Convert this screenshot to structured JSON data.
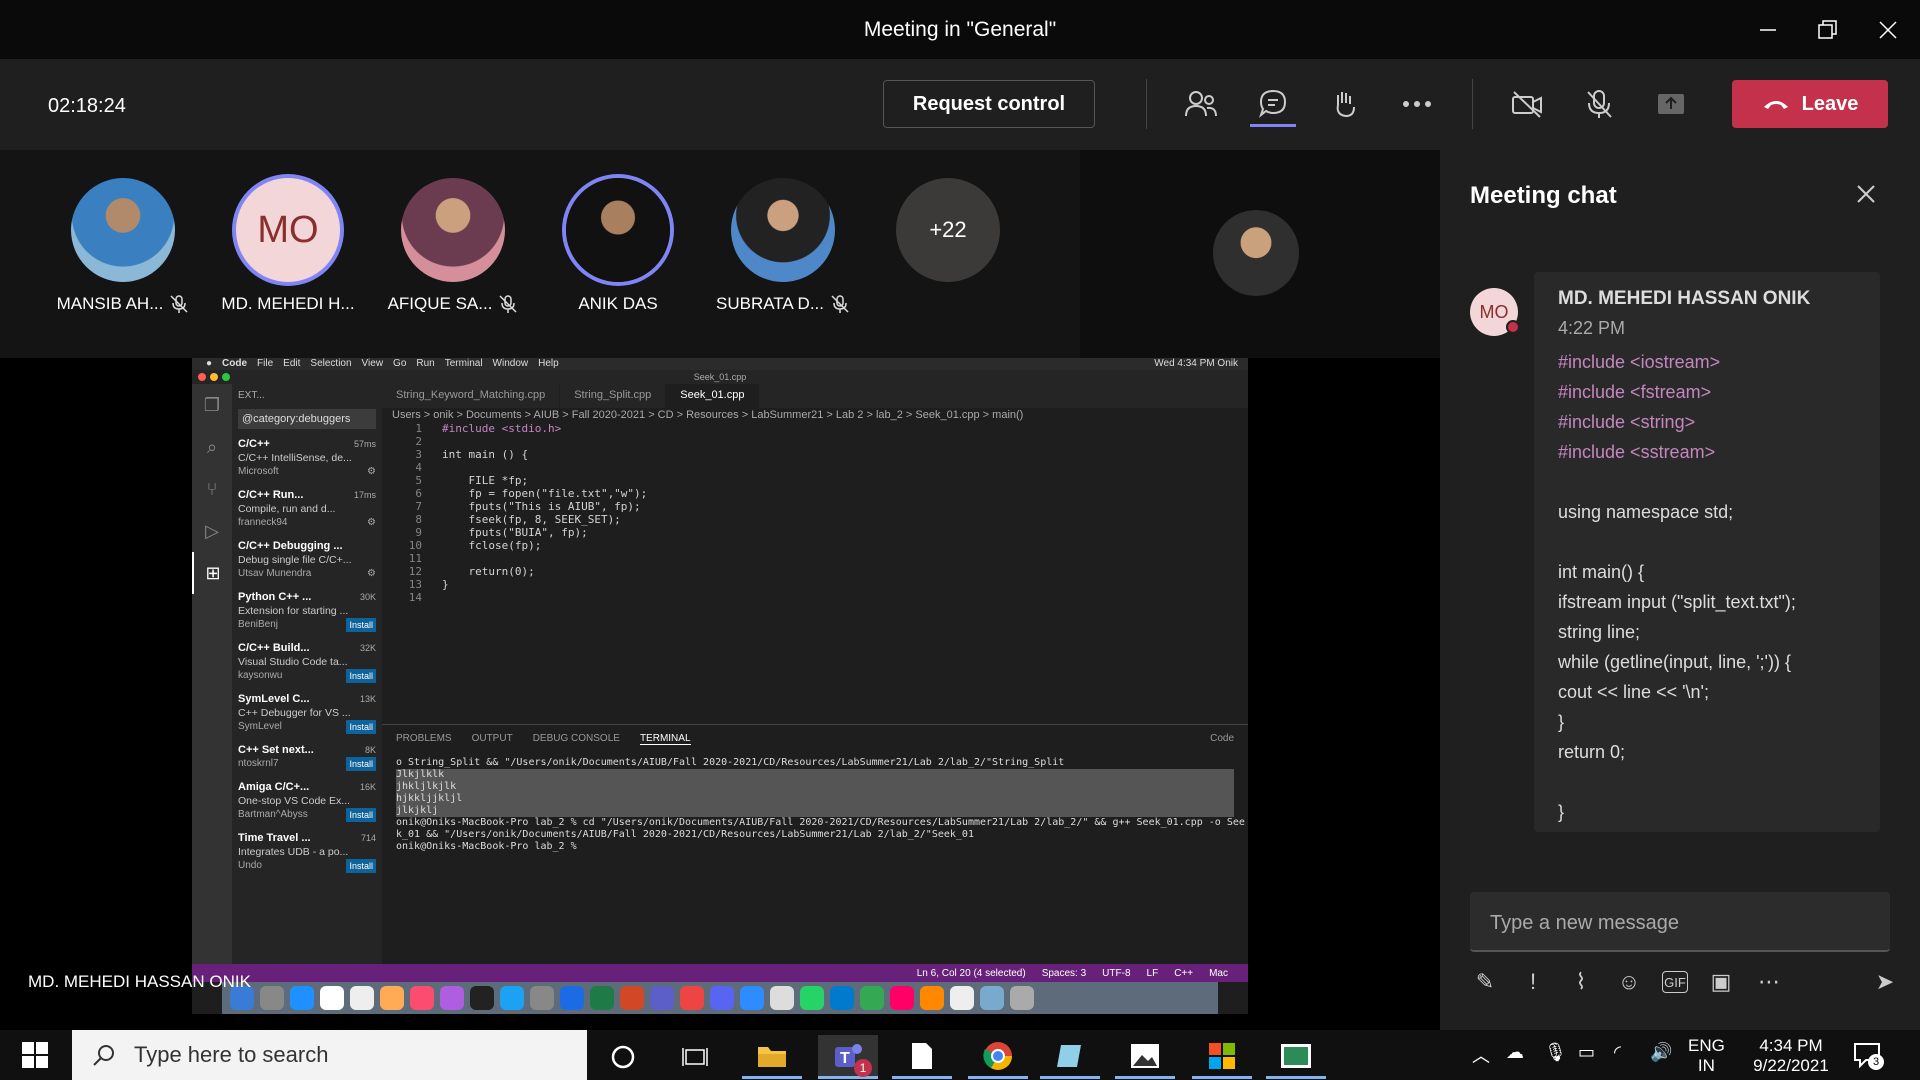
{
  "window": {
    "title": "Meeting in \"General\""
  },
  "meeting_bar": {
    "timer": "02:18:24",
    "request_control_label": "Request control",
    "leave_label": "Leave"
  },
  "participants": [
    {
      "name": "MANSIB AH...",
      "muted": true,
      "avatar": "photo"
    },
    {
      "name": "MD. MEHEDI H...",
      "initials": "MO",
      "muted": false,
      "speaking": true
    },
    {
      "name": "AFIQUE SA...",
      "muted": true,
      "avatar": "photo"
    },
    {
      "name": "ANIK DAS",
      "muted": false,
      "speaking": true,
      "avatar": "photo"
    },
    {
      "name": "SUBRATA D...",
      "muted": true,
      "avatar": "photo"
    }
  ],
  "more_participants": "+22",
  "shared_screen": {
    "presenter_label": "MD. MEHEDI HASSAN ONIK",
    "mac_menu": [
      "Code",
      "File",
      "Edit",
      "Selection",
      "View",
      "Go",
      "Run",
      "Terminal",
      "Window",
      "Help"
    ],
    "mac_menu_right": "Wed 4:34 PM   Onik",
    "window_title": "Seek_01.cpp",
    "sidebar_header": "EXT...",
    "sidebar_filter": "@category:debuggers",
    "extensions": [
      {
        "name": "C/C++",
        "meta": "57ms",
        "desc": "C/C++ IntelliSense, de...",
        "publisher": "Microsoft",
        "install": ""
      },
      {
        "name": "C/C++ Run...",
        "meta": "17ms",
        "desc": "Compile, run and d...",
        "publisher": "franneck94",
        "install": ""
      },
      {
        "name": "C/C++ Debugging ...",
        "meta": "",
        "desc": "Debug single file C/C+...",
        "publisher": "Utsav Munendra",
        "install": ""
      },
      {
        "name": "Python C++ ...",
        "meta": "30K",
        "desc": "Extension for starting ...",
        "publisher": "BeniBenj",
        "install": "Install"
      },
      {
        "name": "C/C++ Build...",
        "meta": "32K",
        "desc": "Visual Studio Code ta...",
        "publisher": "kaysonwu",
        "install": "Install"
      },
      {
        "name": "SymLevel C...",
        "meta": "13K",
        "desc": "C++ Debugger for VS ...",
        "publisher": "SymLevel",
        "install": "Install"
      },
      {
        "name": "C++ Set next...",
        "meta": "8K",
        "desc": "",
        "publisher": "ntoskrnl7",
        "install": "Install"
      },
      {
        "name": "Amiga C/C+...",
        "meta": "16K",
        "desc": "One-stop VS Code Ex...",
        "publisher": "Bartman^Abyss",
        "install": "Install"
      },
      {
        "name": "Time Travel ...",
        "meta": "714",
        "desc": "Integrates UDB - a po...",
        "publisher": "Undo",
        "install": "Install"
      }
    ],
    "tabs": [
      "String_Keyword_Matching.cpp",
      "String_Split.cpp",
      "Seek_01.cpp"
    ],
    "breadcrumb": "Users > onik > Documents > AIUB > Fall 2020-2021 > CD > Resources > LabSummer21 > Lab 2 > lab_2 > Seek_01.cpp > main()",
    "code_lines": [
      "#include <stdio.h>",
      "",
      "int main () {",
      "",
      "    FILE *fp;",
      "    fp = fopen(\"file.txt\",\"w\");",
      "    fputs(\"This is AIUB\", fp);",
      "    fseek(fp, 8, SEEK_SET);",
      "    fputs(\"BUIA\", fp);",
      "    fclose(fp);",
      "",
      "    return(0);",
      "}",
      ""
    ],
    "panel_tabs": [
      "PROBLEMS",
      "OUTPUT",
      "DEBUG CONSOLE",
      "TERMINAL"
    ],
    "panel_right": "Code",
    "terminal_lines": [
      "o String_Split && \"/Users/onik/Documents/AIUB/Fall 2020-2021/CD/Resources/LabSummer21/Lab 2/lab_2/\"String_Split",
      "Jlkjlklk",
      "jhkljlkjlk",
      "hjkkljjkljl",
      "jlkjklj",
      "onik@Oniks-MacBook-Pro lab_2 % cd \"/Users/onik/Documents/AIUB/Fall 2020-2021/CD/Resources/LabSummer21/Lab 2/lab_2/\" && g++ Seek_01.cpp -o See",
      "k_01 && \"/Users/onik/Documents/AIUB/Fall 2020-2021/CD/Resources/LabSummer21/Lab 2/lab_2/\"Seek_01",
      "onik@Oniks-MacBook-Pro lab_2 % "
    ],
    "status_items": [
      "Ln 6, Col 20 (4 selected)",
      "Spaces: 3",
      "UTF-8",
      "LF",
      "C++",
      "Mac"
    ]
  },
  "chat": {
    "title": "Meeting chat",
    "message": {
      "avatar_initials": "MO",
      "author": "MD. MEHEDI HASSAN ONIK",
      "time": "4:22 PM",
      "lines": [
        "#include <iostream>",
        "#include <fstream>",
        "#include <string>",
        "#include <sstream>",
        "",
        "using namespace std;",
        "",
        "int main() {",
        "ifstream input (\"split_text.txt\");",
        "string line;",
        "while (getline(input, line, ';')) {",
        "cout << line << '\\n';",
        "}",
        "return 0;",
        "",
        "}"
      ]
    },
    "compose_placeholder": "Type a new message"
  },
  "taskbar": {
    "search_placeholder": "Type here to search",
    "teams_badge": "1",
    "lang_top": "ENG",
    "lang_bottom": "IN",
    "time": "4:34 PM",
    "date": "9/22/2021",
    "notif_count": "3"
  },
  "colors": {
    "leave": "#c4314b",
    "accent": "#7f85f5",
    "vscode_status": "#68217a"
  }
}
